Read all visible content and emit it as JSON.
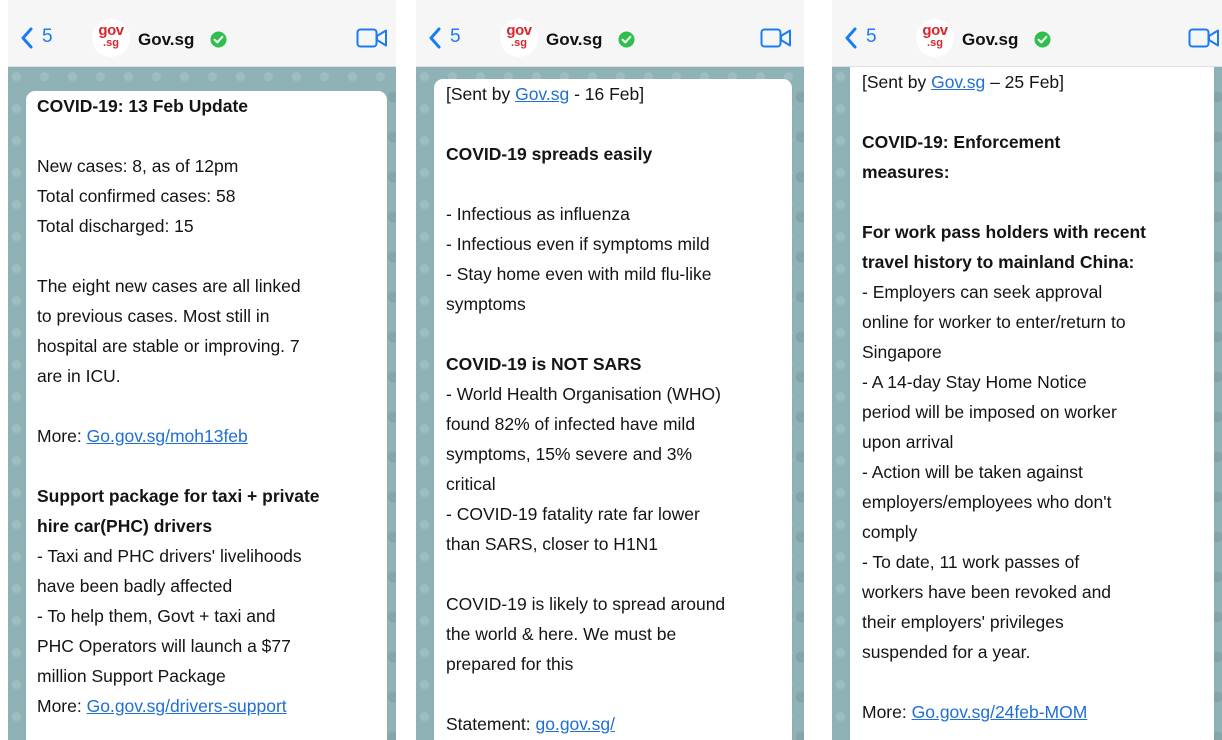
{
  "common": {
    "back_count": "5",
    "contact_name": "Gov.sg",
    "logo_line1": "gov",
    "logo_line2": ".sg",
    "colors": {
      "ios_blue": "#1a7cf5",
      "verified_green": "#2fbf4f",
      "logo_red": "#d7262d",
      "chat_wallpaper": "#8fb2b6",
      "link": "#1f6fd6"
    },
    "icons": [
      "chevron-left-icon",
      "verified-badge-icon",
      "video-call-icon"
    ]
  },
  "screens": [
    {
      "title": "COVID-19: 13 Feb Update",
      "stats": [
        "New cases: 8, as of 12pm",
        "Total confirmed cases: 58",
        "Total discharged: 15"
      ],
      "para": [
        "The eight new cases are all linked",
        "to previous cases. Most still in",
        "hospital are stable or improving. 7",
        "are in ICU."
      ],
      "more_label": "More: ",
      "more_link": "Go.gov.sg/moh13feb",
      "heading2": [
        "Support package for taxi + private",
        "hire car(PHC) drivers"
      ],
      "bullets": [
        "- Taxi and PHC drivers' livelihoods",
        "have been badly affected",
        "- To help them, Govt + taxi and",
        "PHC Operators will launch a $77",
        "million Support Package"
      ],
      "more2_label": "More: ",
      "more2_link": "Go.gov.sg/drivers-support"
    },
    {
      "sent_prefix": "[Sent by ",
      "sent_link": "Gov.sg",
      "sent_suffix": " - 16 Feb]",
      "heading1": "COVID-19 spreads easily",
      "list1": [
        "- Infectious as influenza",
        "- Infectious even if symptoms mild",
        "- Stay home even with mild flu-like",
        "symptoms"
      ],
      "heading2": "COVID-19 is NOT SARS",
      "list2": [
        "- World Health Organisation (WHO)",
        "found 82% of infected have mild",
        "symptoms, 15% severe and 3%",
        "critical",
        "- COVID-19 fatality rate far lower",
        "than SARS, closer to H1N1"
      ],
      "para": [
        "COVID-19 is likely to spread around",
        "the world & here. We must be",
        "prepared for this"
      ],
      "statement_label": "Statement: ",
      "statement_link": "go.gov.sg/"
    },
    {
      "sent_prefix": "[Sent by ",
      "sent_link": "Gov.sg",
      "sent_suffix": " – 25 Feb]",
      "title": [
        "COVID-19: Enforcement",
        "measures:"
      ],
      "heading2": [
        "For work pass holders with recent",
        "travel history to mainland China:"
      ],
      "lines": [
        "- Employers can seek approval",
        "online for worker to enter/return to",
        "Singapore",
        "- A 14-day Stay Home Notice",
        "period will be imposed on worker",
        "upon arrival",
        "- Action will be taken against",
        "employers/employees who don't",
        "comply",
        "- To date, 11 work passes of",
        "workers have been revoked and",
        "their employers' privileges",
        "suspended for a year."
      ],
      "more_label": "More: ",
      "more_link": "Go.gov.sg/24feb-MOM"
    }
  ]
}
